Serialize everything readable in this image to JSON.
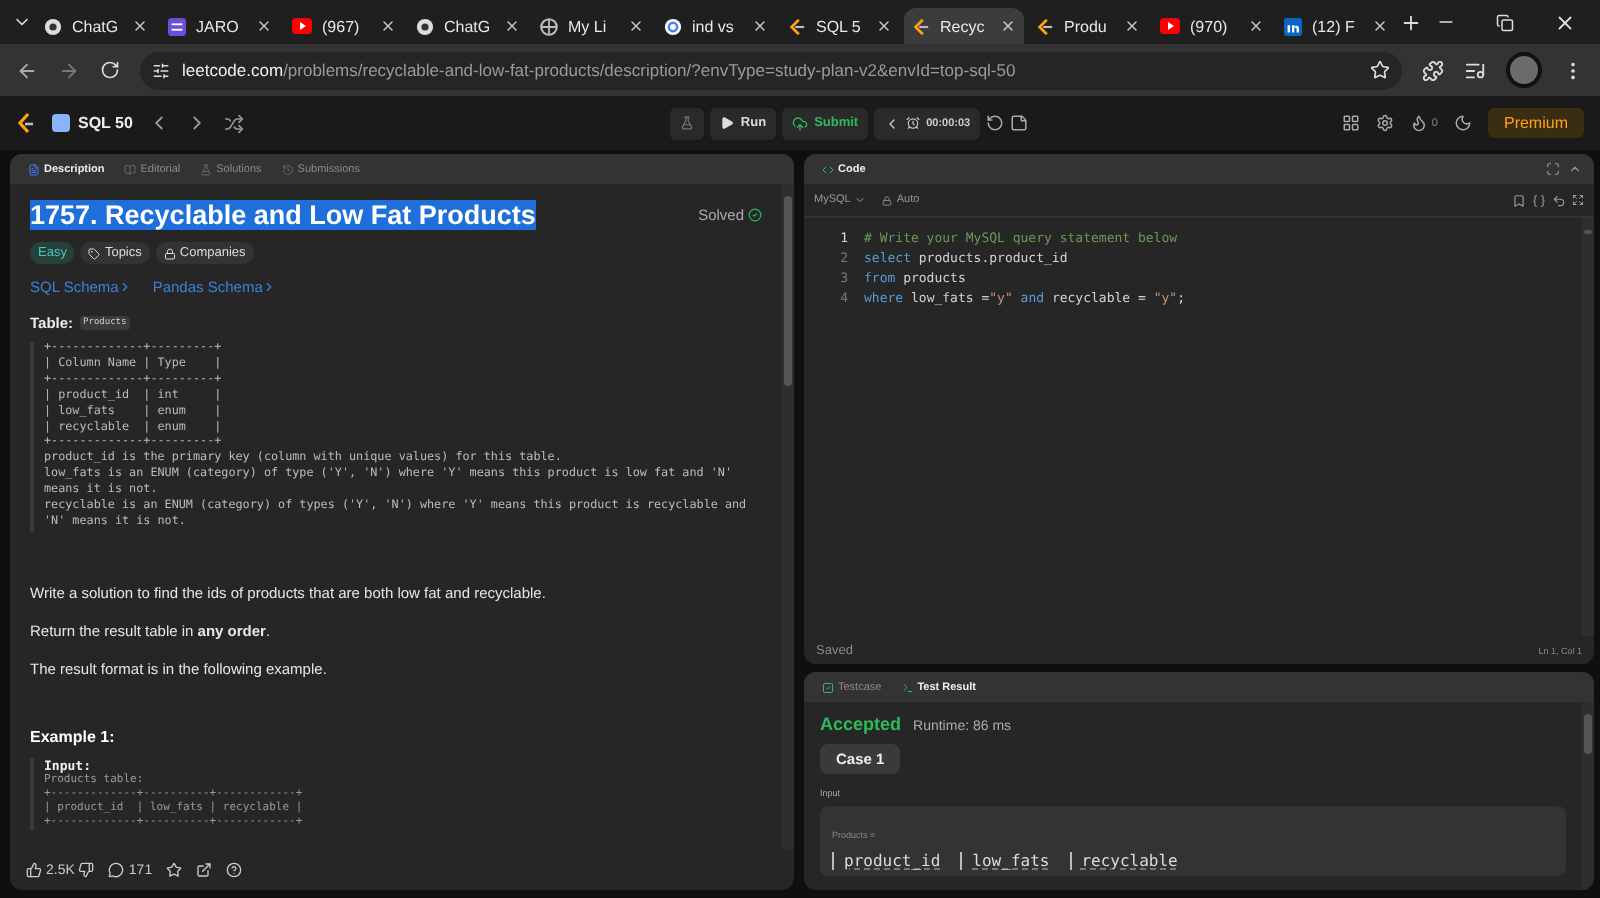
{
  "browser": {
    "tabs": [
      {
        "label": "ChatG",
        "kind": "chat",
        "selected": false
      },
      {
        "label": "JARO",
        "kind": "app",
        "selected": false
      },
      {
        "label": "(967)",
        "kind": "video",
        "selected": false
      },
      {
        "label": "ChatG",
        "kind": "chat",
        "selected": false
      },
      {
        "label": "My Li",
        "kind": "globe",
        "selected": false
      },
      {
        "label": "ind vs",
        "kind": "search",
        "selected": false
      },
      {
        "label": "SQL 5",
        "kind": "code",
        "selected": false
      },
      {
        "label": "Recyc",
        "kind": "code",
        "selected": true
      },
      {
        "label": "Produ",
        "kind": "code",
        "selected": false
      },
      {
        "label": "(970)",
        "kind": "video",
        "selected": false
      },
      {
        "label": "(12) F",
        "kind": "network",
        "selected": false
      }
    ],
    "url_domain": "leetcode.com",
    "url_path": "/problems/recyclable-and-low-fat-products/description/?envType=study-plan-v2&envId=top-sql-50"
  },
  "nav": {
    "title": "SQL 50",
    "run": "Run",
    "submit": "Submit",
    "timer": "00:00:03",
    "streak": "0",
    "premium": "Premium"
  },
  "left_tabs": [
    {
      "label": "Description",
      "selected": true
    },
    {
      "label": "Editorial",
      "selected": false
    },
    {
      "label": "Solutions",
      "selected": false
    },
    {
      "label": "Submissions",
      "selected": false
    }
  ],
  "problem": {
    "title": "1757. Recyclable and Low Fat Products",
    "title_highlighted": true,
    "status": "Solved",
    "difficulty": "Easy",
    "tags": [
      "Topics",
      "Companies"
    ],
    "links": [
      "SQL Schema",
      "Pandas Schema"
    ],
    "table_label": "Table:",
    "table_name": "Products",
    "schema_lines": [
      "+-------------+---------+",
      "| Column Name | Type    |",
      "+-------------+---------+",
      "| product_id  | int     |",
      "| low_fats    | enum    |",
      "| recyclable  | enum    |",
      "+-------------+---------+",
      "product_id is the primary key (column with unique values) for this table.",
      "low_fats is an ENUM (category) of type ('Y', 'N') where 'Y' means this product is low fat and 'N' means it is not.",
      "recyclable is an ENUM (category) of types ('Y', 'N') where 'Y' means this product is recyclable and 'N' means it is not."
    ],
    "paragraphs": [
      "Write a solution to find the ids of products that are both low fat and recyclable.",
      "Return the result table in **any order**.",
      "The result format is in the following example."
    ],
    "example_title": "Example 1:",
    "example_input_label": "Input:",
    "example_lines": [
      "Products table:",
      "+-------------+----------+------------+",
      "| product_id  | low_fats | recyclable |",
      "+-------------+----------+------------+"
    ]
  },
  "footer": {
    "likes": "2.5K",
    "comments": "171"
  },
  "code": {
    "title": "Code",
    "language": "MySQL",
    "mode": "Auto",
    "lines": [
      {
        "number": "1",
        "current": true,
        "tokens": [
          {
            "kind": "comment",
            "text": "# Write your MySQL query statement below"
          }
        ]
      },
      {
        "number": "2",
        "current": false,
        "tokens": [
          {
            "kind": "keyword",
            "text": "select"
          },
          {
            "kind": "plain",
            "text": " products.product_id"
          }
        ]
      },
      {
        "number": "3",
        "current": false,
        "tokens": [
          {
            "kind": "keyword",
            "text": "from"
          },
          {
            "kind": "plain",
            "text": " products"
          }
        ]
      },
      {
        "number": "4",
        "current": false,
        "tokens": [
          {
            "kind": "keyword",
            "text": "where"
          },
          {
            "kind": "plain",
            "text": " low_fats ="
          },
          {
            "kind": "string",
            "text": "\"y\""
          },
          {
            "kind": "keyword",
            "text": " and"
          },
          {
            "kind": "plain",
            "text": " recyclable = "
          },
          {
            "kind": "string",
            "text": "\"y\""
          },
          {
            "kind": "plain",
            "text": ";"
          }
        ]
      }
    ],
    "status": "Saved",
    "cursor": "Ln 1, Col 1"
  },
  "result": {
    "tabs": [
      {
        "label": "Testcase",
        "selected": false
      },
      {
        "label": "Test Result",
        "selected": true
      }
    ],
    "verdict": "Accepted",
    "runtime": "Runtime: 86 ms",
    "cases": [
      {
        "label": "Case 1",
        "selected": true
      }
    ],
    "input_label": "Input",
    "table_label": "Products =",
    "columns": [
      "product_id",
      "low_fats",
      "recyclable"
    ]
  }
}
